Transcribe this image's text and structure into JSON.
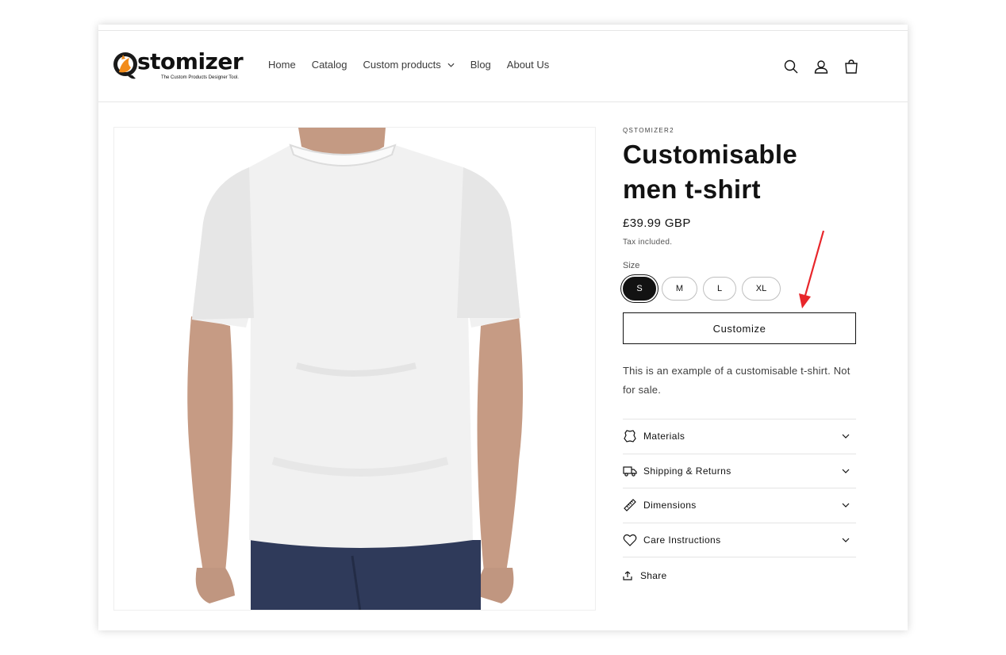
{
  "brand": {
    "logo_word": "stomizer",
    "tagline": "The Custom Products Designer Tool."
  },
  "nav": {
    "items": [
      {
        "label": "Home"
      },
      {
        "label": "Catalog"
      },
      {
        "label": "Custom products",
        "has_dropdown": true
      },
      {
        "label": "Blog"
      },
      {
        "label": "About Us"
      }
    ]
  },
  "header_icons": [
    "search-icon",
    "account-icon",
    "cart-icon"
  ],
  "product": {
    "vendor": "QSTOMIZER2",
    "title": "Customisable men t-shirt",
    "price": "£39.99 GBP",
    "tax_note": "Tax included.",
    "size_label": "Size",
    "sizes": [
      {
        "label": "S",
        "selected": true
      },
      {
        "label": "M",
        "selected": false
      },
      {
        "label": "L",
        "selected": false
      },
      {
        "label": "XL",
        "selected": false
      }
    ],
    "customize_label": "Customize",
    "description": "This is an example of a customisable t-shirt. Not for sale.",
    "accordion": [
      {
        "label": "Materials",
        "icon": "leather-icon"
      },
      {
        "label": "Shipping & Returns",
        "icon": "truck-icon"
      },
      {
        "label": "Dimensions",
        "icon": "ruler-icon"
      },
      {
        "label": "Care Instructions",
        "icon": "heart-icon"
      }
    ],
    "share_label": "Share"
  },
  "colors": {
    "text": "#121212",
    "border": "#e4e4e4",
    "annotation": "#e8262b",
    "logo_orange": "#f28c1c"
  }
}
